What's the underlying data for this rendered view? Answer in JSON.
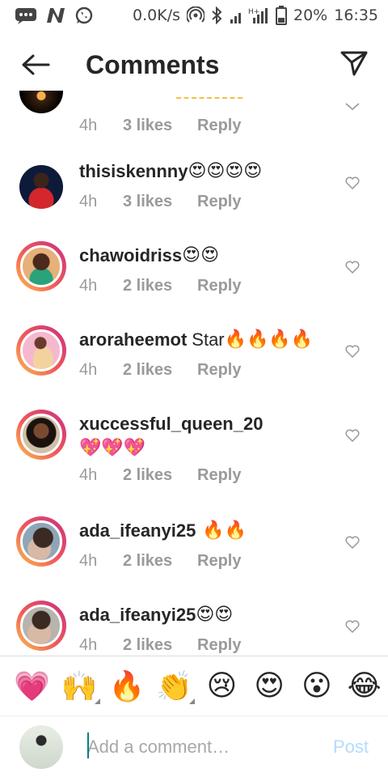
{
  "status_bar": {
    "network_speed": "0.0K/s",
    "battery_percent": "20%",
    "time": "16:35",
    "icons": [
      "message-icon",
      "n-app-icon",
      "whatsapp-icon",
      "hotspot-icon",
      "bluetooth-icon",
      "signal-icon",
      "battery-icon"
    ]
  },
  "header": {
    "title": "Comments",
    "back_icon": "arrow-left-icon",
    "share_icon": "paper-plane-icon"
  },
  "comments": [
    {
      "username": "",
      "text": "",
      "emoji": "",
      "time": "4h",
      "likes": "3 likes",
      "reply": "Reply",
      "ring": false
    },
    {
      "username": "thisiskennny",
      "text": "",
      "emoji": "😍😍😍😍",
      "time": "4h",
      "likes": "3 likes",
      "reply": "Reply",
      "ring": false
    },
    {
      "username": "chawoidriss",
      "text": "",
      "emoji": "😍😍",
      "time": "4h",
      "likes": "2 likes",
      "reply": "Reply",
      "ring": true
    },
    {
      "username": "aroraheemot",
      "text": "Star",
      "emoji": "🔥🔥🔥🔥",
      "time": "4h",
      "likes": "2 likes",
      "reply": "Reply",
      "ring": true
    },
    {
      "username": "xuccessful_queen_20",
      "text": "",
      "emoji": "💖💖💖",
      "time": "4h",
      "likes": "2 likes",
      "reply": "Reply",
      "ring": true
    },
    {
      "username": "ada_ifeanyi25",
      "text": "",
      "emoji": "🔥🔥",
      "time": "4h",
      "likes": "2 likes",
      "reply": "Reply",
      "ring": true
    },
    {
      "username": "ada_ifeanyi25",
      "text": "",
      "emoji": "😍😍",
      "time": "4h",
      "likes": "2 likes",
      "reply": "Reply",
      "ring": true
    }
  ],
  "emoji_bar": [
    "💗",
    "🙌",
    "🔥",
    "👏",
    "😢",
    "😍",
    "😮",
    "😂"
  ],
  "composer": {
    "placeholder": "Add a comment…",
    "post_label": "Post"
  },
  "colors": {
    "text": "#262626",
    "muted": "#9a9a9a",
    "post_disabled": "#b3dbff",
    "story_ring_start": "#f9c24d",
    "story_ring_end": "#c9307f"
  }
}
